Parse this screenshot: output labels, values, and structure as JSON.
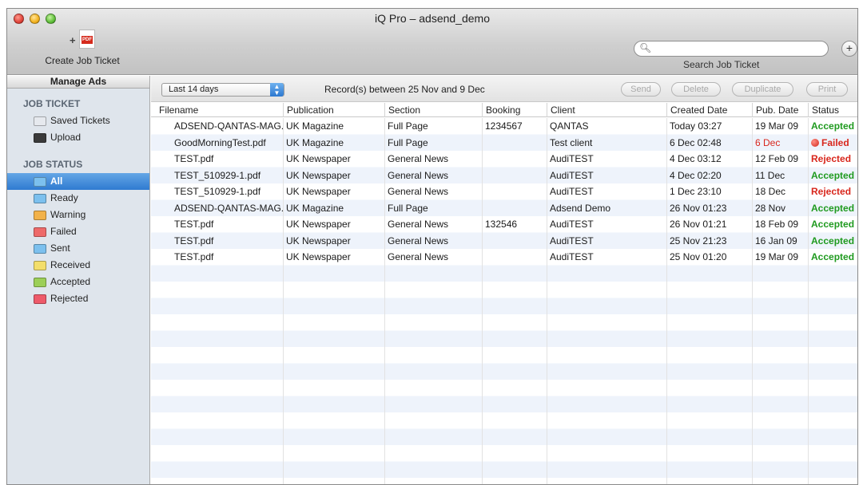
{
  "window": {
    "title": "iQ Pro – adsend_demo"
  },
  "toolbar": {
    "create_label": "Create Job Ticket",
    "search_label": "Search Job Ticket",
    "search_placeholder": "",
    "add_symbol": "+"
  },
  "sidebar": {
    "tab_label": "Manage Ads",
    "job_ticket_heading": "JOB TICKET",
    "job_ticket_items": [
      {
        "label": "Saved Tickets",
        "icon": "folder-icon",
        "color": "#e6e9ee"
      },
      {
        "label": "Upload",
        "icon": "folder-icon",
        "color": "#3a3a3a"
      }
    ],
    "job_status_heading": "JOB STATUS",
    "job_status_items": [
      {
        "label": "All",
        "icon": "folder-icon",
        "color": "#7cc0ee",
        "selected": true
      },
      {
        "label": "Ready",
        "icon": "folder-icon",
        "color": "#7cc0ee"
      },
      {
        "label": "Warning",
        "icon": "folder-icon",
        "color": "#f2b24a"
      },
      {
        "label": "Failed",
        "icon": "folder-icon",
        "color": "#ee6a6a"
      },
      {
        "label": "Sent",
        "icon": "folder-icon",
        "color": "#7cc0ee"
      },
      {
        "label": "Received",
        "icon": "folder-icon",
        "color": "#f3de6a"
      },
      {
        "label": "Accepted",
        "icon": "folder-icon",
        "color": "#9ccf58"
      },
      {
        "label": "Rejected",
        "icon": "folder-icon",
        "color": "#ee5a6a"
      }
    ]
  },
  "filter": {
    "range_value": "Last 14 days",
    "records_text": "Record(s) between 25 Nov and 9 Dec",
    "buttons": [
      "Send",
      "Delete",
      "Duplicate",
      "Print"
    ]
  },
  "table": {
    "columns": [
      "Filename",
      "Publication",
      "Section",
      "Booking",
      "Client",
      "Created Date",
      "Pub. Date",
      "Status"
    ],
    "rows": [
      {
        "filename": "ADSEND-QANTAS-MAG.",
        "publication": "UK Magazine",
        "section": "Full Page",
        "booking": "1234567",
        "client": "QANTAS",
        "created": "Today 03:27",
        "pub_date": "19 Mar 09",
        "status": "Accepted"
      },
      {
        "filename": "GoodMorningTest.pdf",
        "publication": "UK Magazine",
        "section": "Full Page",
        "booking": "",
        "client": "Test client",
        "created": "6 Dec 02:48",
        "pub_date": "6 Dec",
        "status": "Failed"
      },
      {
        "filename": "TEST.pdf",
        "publication": "UK Newspaper",
        "section": "General News",
        "booking": "",
        "client": "AudiTEST",
        "created": "4 Dec 03:12",
        "pub_date": "12 Feb 09",
        "status": "Rejected"
      },
      {
        "filename": "TEST_510929-1.pdf",
        "publication": "UK Newspaper",
        "section": "General News",
        "booking": "",
        "client": "AudiTEST",
        "created": "4 Dec 02:20",
        "pub_date": "11 Dec",
        "status": "Accepted"
      },
      {
        "filename": "TEST_510929-1.pdf",
        "publication": "UK Newspaper",
        "section": "General News",
        "booking": "",
        "client": "AudiTEST",
        "created": "1 Dec 23:10",
        "pub_date": "18 Dec",
        "status": "Rejected"
      },
      {
        "filename": "ADSEND-QANTAS-MAG.",
        "publication": "UK Magazine",
        "section": "Full Page",
        "booking": "",
        "client": "Adsend Demo",
        "created": "26 Nov 01:23",
        "pub_date": "28 Nov",
        "status": "Accepted"
      },
      {
        "filename": "TEST.pdf",
        "publication": "UK Newspaper",
        "section": "General News",
        "booking": "132546",
        "client": "AudiTEST",
        "created": "26 Nov 01:21",
        "pub_date": "18 Feb 09",
        "status": "Accepted"
      },
      {
        "filename": "TEST.pdf",
        "publication": "UK Newspaper",
        "section": "General News",
        "booking": "",
        "client": "AudiTEST",
        "created": "25 Nov 21:23",
        "pub_date": "16 Jan 09",
        "status": "Accepted"
      },
      {
        "filename": "TEST.pdf",
        "publication": "UK Newspaper",
        "section": "General News",
        "booking": "",
        "client": "AudiTEST",
        "created": "25 Nov 01:20",
        "pub_date": "19 Mar 09",
        "status": "Accepted"
      }
    ]
  },
  "colors": {
    "accepted": "#1f9a1f",
    "rejected": "#d8261c",
    "failed": "#d8261c",
    "selection": "#2f7bd1"
  }
}
